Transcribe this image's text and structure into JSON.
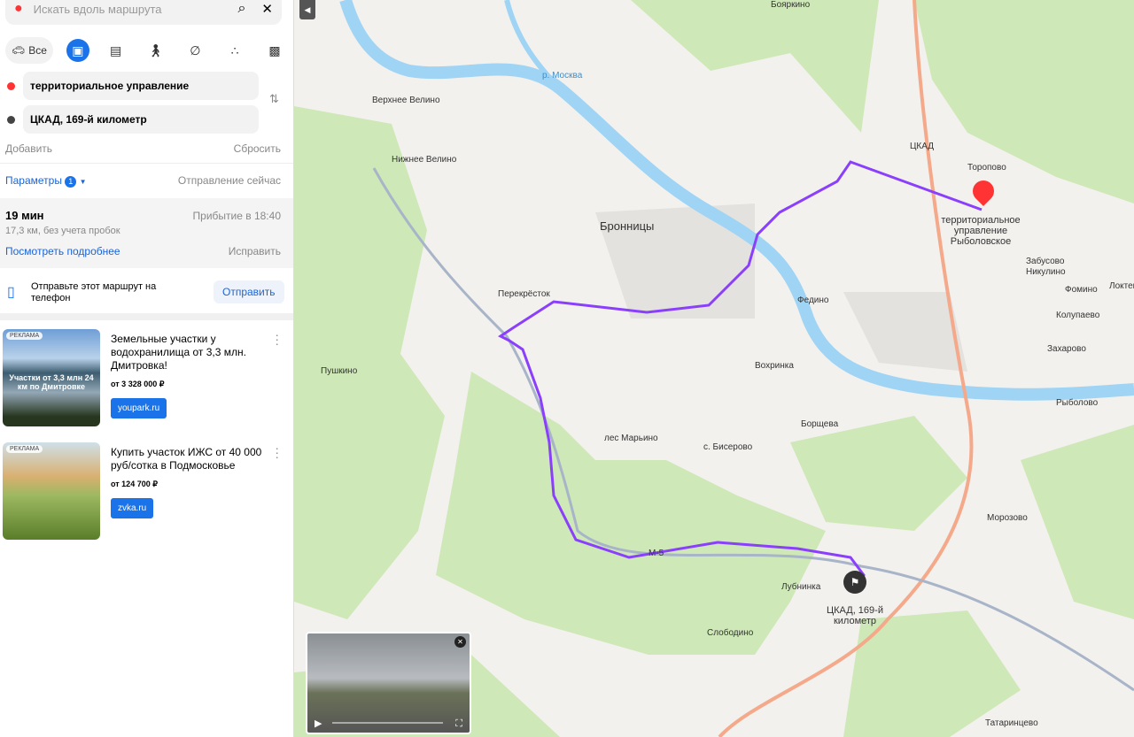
{
  "search": {
    "placeholder": "Искать вдоль маршрута"
  },
  "modes": {
    "all": "Все"
  },
  "points": {
    "from": "территориальное управление Рыболовское",
    "to": "ЦКАД, 169-й километр"
  },
  "actions": {
    "add": "Добавить",
    "reset": "Сбросить"
  },
  "params": {
    "label": "Параметры",
    "count": "1",
    "departure": "Отправление сейчас"
  },
  "route": {
    "time": "19 мин",
    "arrival": "Прибытие в 18:40",
    "distance": "17,3 км, без учета пробок",
    "details": "Посмотреть подробнее",
    "fix": "Исправить"
  },
  "send": {
    "text": "Отправьте этот маршрут на телефон",
    "button": "Отправить"
  },
  "ads": [
    {
      "tag": "РЕКЛАМА",
      "image_text": "Участки от 3,3 млн 24 км по Дмитровке",
      "title": "Земельные участки у водохранилища от 3,3 млн. Дмитровка!",
      "price": "от 3 328 000 ₽",
      "button": "youpark.ru"
    },
    {
      "tag": "РЕКЛАМА",
      "title": "Купить участок ИЖС от 40 000 руб/сотка в Подмосковье",
      "price": "от 124 700 ₽",
      "button": "zvka.ru"
    }
  ],
  "map": {
    "labels": [
      "Бояркино",
      "Верхнее Велино",
      "Нижнее Велино",
      "Бронницы",
      "Торопово",
      "Забусово",
      "Никулино",
      "Фомино",
      "Локтево",
      "Колупаево",
      "Захарово",
      "Федино",
      "Вохринка",
      "Рыболово",
      "Борщева",
      "Пушкино",
      "лес Марьино",
      "с. Бисерово",
      "Морозово",
      "Лубнинка",
      "Слободино",
      "Татаринцево",
      "Перекрёсток",
      "р. Москва",
      "ЦКАД",
      "М-5"
    ],
    "destination_label": "территориальное управление Рыболовское",
    "start_label": "ЦКАД, 169-й километр",
    "route_color": "#8a3ffc"
  }
}
